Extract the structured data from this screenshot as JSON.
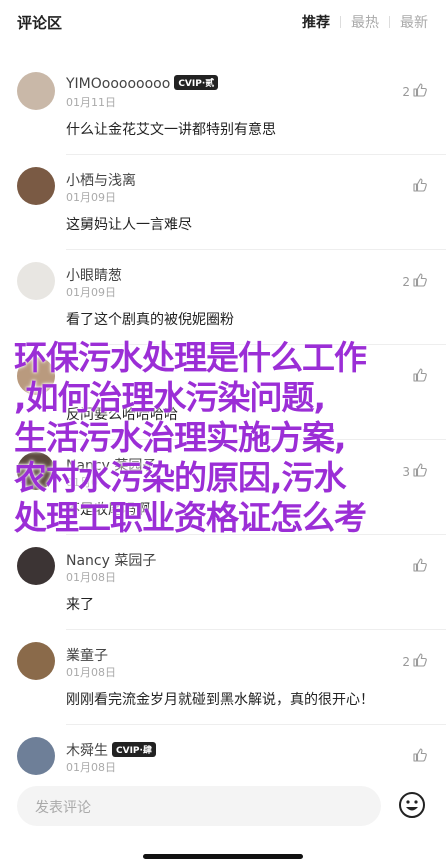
{
  "header": {
    "title": "评论区",
    "tabs": [
      "推荐",
      "最热",
      "最新"
    ],
    "active_tab": 0
  },
  "comments": [
    {
      "name": "YIMOoooooooo",
      "badge": "CVIP·贰",
      "date": "01月11日",
      "text": "什么让金花艾文一讲都特别有意思",
      "likes": "2",
      "avatar_color": "#c9b8a8"
    },
    {
      "name": "小栖与浅离",
      "badge": "",
      "date": "01月09日",
      "text": "这舅妈让人一言难尽",
      "likes": "",
      "avatar_color": "#7a5a44"
    },
    {
      "name": "小眼睛葱",
      "badge": "",
      "date": "01月09日",
      "text": "看了这个剧真的被倪妮圈粉",
      "likes": "2",
      "avatar_color": "#e8e6e2"
    },
    {
      "name": "",
      "badge": "",
      "date": "",
      "text": "反问要么哈哈哈哈",
      "likes": "",
      "avatar_color": "#b99a7e"
    },
    {
      "name": "Nancy 菜园子",
      "badge": "",
      "date": "01月0",
      "text": "不是收尾吗啊",
      "likes": "3",
      "avatar_color": "#5c4a3e"
    },
    {
      "name": "Nancy 菜园子",
      "badge": "",
      "date": "01月08日",
      "text": "来了",
      "likes": "",
      "avatar_color": "#3c3434"
    },
    {
      "name": "業童子",
      "badge": "",
      "date": "01月08日",
      "text": "刚刚看完流金岁月就碰到黑水解说，真的很开心！",
      "likes": "2",
      "avatar_color": "#8a6a4a"
    },
    {
      "name": "木舜生",
      "badge": "CVIP·肆",
      "date": "01月08日",
      "text": "",
      "likes": "",
      "avatar_color": "#6e7f98"
    }
  ],
  "overlay_text": [
    "环保污水处理是什么工作",
    ",如何治理水污染问题,",
    "生活污水治理实施方案,",
    "农村水污染的原因,污水",
    "处理工职业资格证怎么考"
  ],
  "footer": {
    "placeholder": "发表评论"
  },
  "colors": {
    "overlay": "#9b2ed6"
  }
}
